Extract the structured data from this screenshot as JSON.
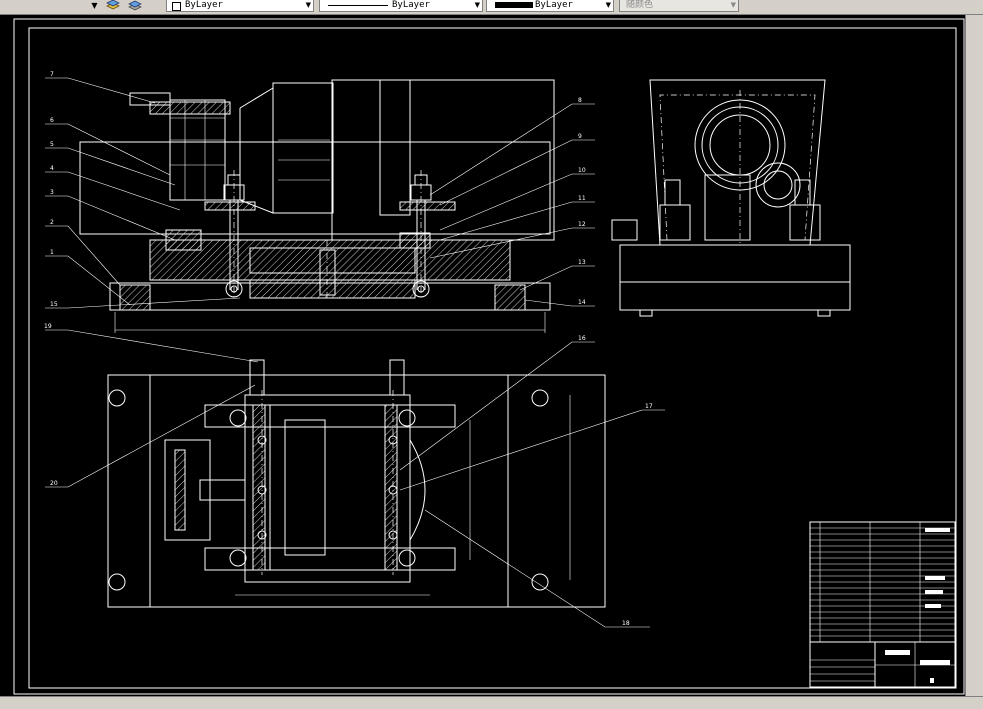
{
  "toolbar": {
    "layer_color": {
      "label": "ByLayer"
    },
    "linetype": {
      "label": "ByLayer"
    },
    "lineweight": {
      "label": "ByLayer"
    },
    "plotstyle": {
      "label": "随颜色"
    }
  },
  "callouts": [
    "1",
    "2",
    "3",
    "4",
    "5",
    "6",
    "7",
    "8",
    "9",
    "10",
    "11",
    "12",
    "13",
    "14",
    "15",
    "16",
    "17",
    "18",
    "19",
    "20"
  ],
  "colors": {
    "background": "#000000",
    "lines": "#ffffff",
    "toolbar": "#d4d0c8"
  }
}
